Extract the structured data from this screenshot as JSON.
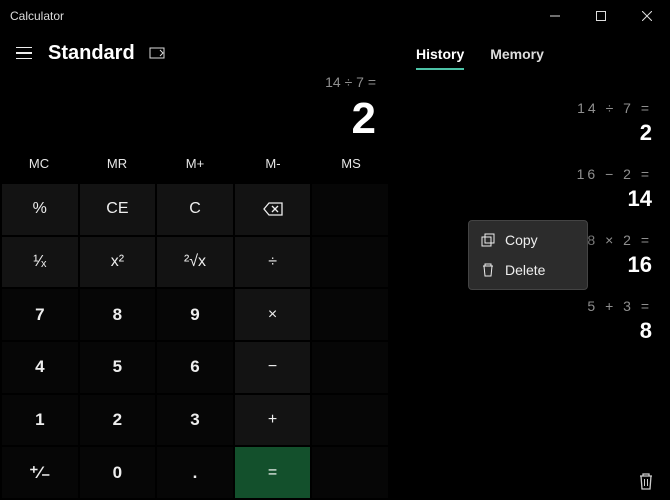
{
  "titlebar": {
    "title": "Calculator"
  },
  "mode": "Standard",
  "expression": "14 ÷ 7 =",
  "result": "2",
  "memory_buttons": {
    "mc": "MC",
    "mr": "MR",
    "mplus": "M+",
    "mminus": "M-",
    "ms": "MS"
  },
  "buttons": {
    "percent": "%",
    "ce": "CE",
    "c": "C",
    "back": "⌫",
    "inv": "¹⁄ₓ",
    "sq": "x²",
    "sqrt": "²√x",
    "div": "÷",
    "7": "7",
    "8": "8",
    "9": "9",
    "mul": "×",
    "4": "4",
    "5": "5",
    "6": "6",
    "sub": "−",
    "1": "1",
    "2": "2",
    "3": "3",
    "add": "+",
    "neg": "⁺⁄₋",
    "0": "0",
    "dot": ".",
    "eq": "="
  },
  "tabs": {
    "history": "History",
    "memory": "Memory",
    "active": "history"
  },
  "history": [
    {
      "expr": "14  ÷  7 =",
      "res": "2"
    },
    {
      "expr": "16  −  2 =",
      "res": "14"
    },
    {
      "expr": "8  ×  2 =",
      "res": "16"
    },
    {
      "expr": "5  +  3 =",
      "res": "8"
    }
  ],
  "context_menu": {
    "copy": "Copy",
    "delete": "Delete"
  }
}
